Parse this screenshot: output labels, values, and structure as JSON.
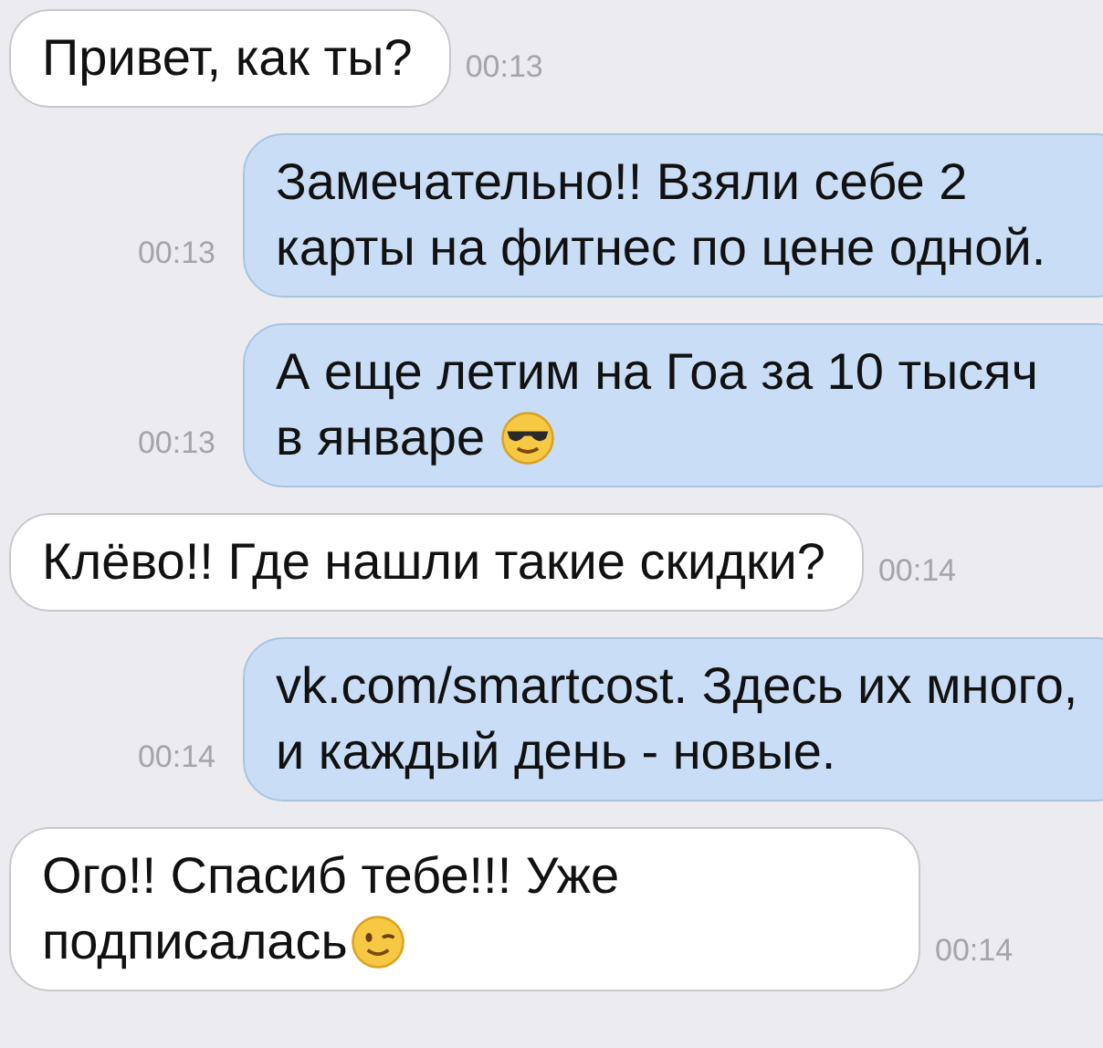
{
  "messages": [
    {
      "kind": "incoming",
      "text": "Привет, как ты?",
      "time": "00:13"
    },
    {
      "kind": "outgoing",
      "text": "Замечательно!! Взяли себе 2 карты на фитнес по цене одной.",
      "time": "00:13"
    },
    {
      "kind": "outgoing",
      "text": "А еще летим на Гоа за 10 тысяч в январе",
      "time": "00:13",
      "emoji": {
        "kind": "sunglasses"
      }
    },
    {
      "kind": "incoming",
      "text": "Клёво!! Где нашли такие скидки?",
      "time": "00:14"
    },
    {
      "kind": "outgoing",
      "text": "vk.com/smartcost. Здесь их много, и каждый день - новые.",
      "time": "00:14"
    },
    {
      "kind": "incoming",
      "text": "Ого!! Спасиб тебе!!! Уже подписалась",
      "time": "00:14",
      "emoji": {
        "kind": "wink"
      }
    }
  ]
}
